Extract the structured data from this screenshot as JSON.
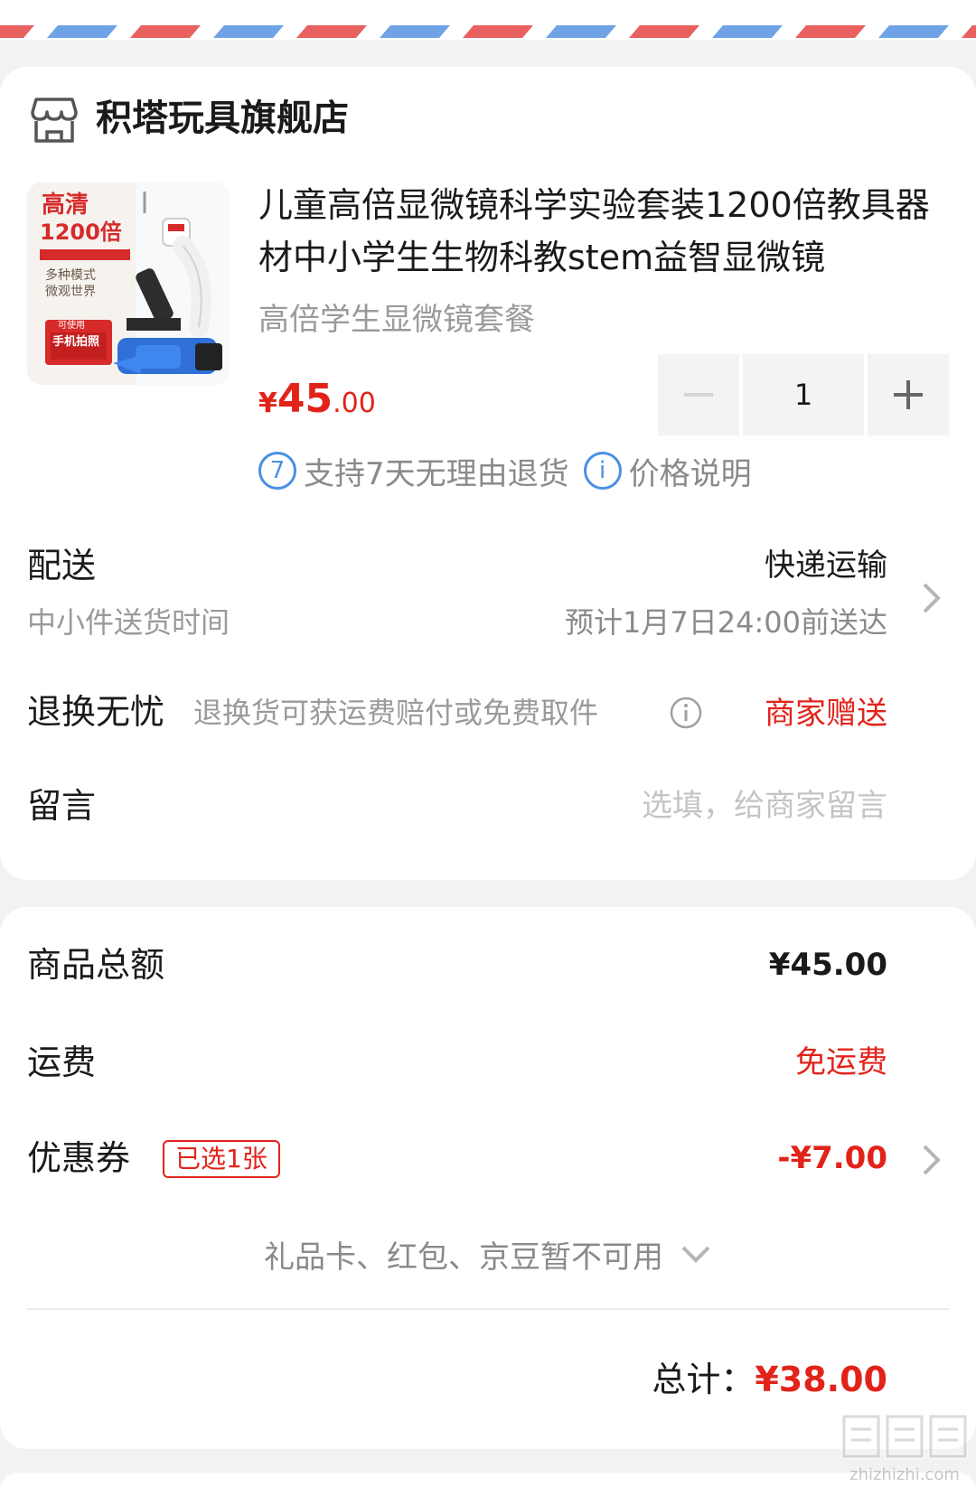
{
  "colors": {
    "accent_red": "#e2231a",
    "link_blue": "#4a90e2",
    "muted": "#9a9a9a"
  },
  "shop": {
    "icon": "store-icon",
    "name": "积塔玩具旗舰店"
  },
  "product": {
    "image": {
      "badge_title": "高清",
      "badge_zoom": "1200倍",
      "caption1": "多种模式",
      "caption2": "微观世界",
      "caption3": "可使用",
      "caption4": "手机拍照"
    },
    "title": "儿童高倍显微镜科学实验套装1200倍教具器材中小学生生物科教stem益智显微镜",
    "spec": "高倍学生显微镜套餐",
    "price": {
      "currency": "¥",
      "integer": "45",
      "decimal": ".00"
    },
    "quantity": "1",
    "services": [
      {
        "icon": "7",
        "label": "支持7天无理由退货"
      },
      {
        "icon": "i",
        "label": "价格说明"
      }
    ]
  },
  "delivery": {
    "label": "配送",
    "method": "快递运输",
    "sub_label": "中小件送货时间",
    "eta": "预计1月7日24:00前送达"
  },
  "returns": {
    "label": "退换无忧",
    "desc": "退换货可获运费赔付或免费取件",
    "value": "商家赠送"
  },
  "message": {
    "label": "留言",
    "placeholder": "选填，给商家留言"
  },
  "summary": {
    "goods_label": "商品总额",
    "goods_value": "¥45.00",
    "shipping_label": "运费",
    "shipping_value": "免运费",
    "coupon_label": "优惠券",
    "coupon_badge": "已选1张",
    "coupon_value": "-¥7.00",
    "unavailable": "礼品卡、红包、京豆暂不可用",
    "total_label": "总计：",
    "total_value": "¥38.00"
  },
  "watermark": {
    "logo": "值值值",
    "url": "zhizhizhi.com"
  }
}
